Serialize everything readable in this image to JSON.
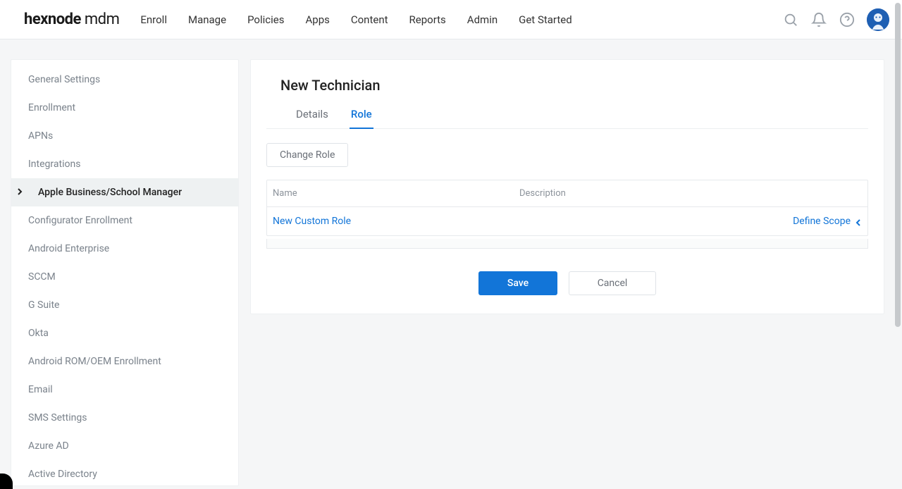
{
  "brand": {
    "bold": "hexnode",
    "light": " mdm"
  },
  "nav": {
    "items": [
      "Enroll",
      "Manage",
      "Policies",
      "Apps",
      "Content",
      "Reports",
      "Admin",
      "Get Started"
    ]
  },
  "sidebar": {
    "items": [
      {
        "label": "General Settings",
        "active": false
      },
      {
        "label": "Enrollment",
        "active": false
      },
      {
        "label": "APNs",
        "active": false
      },
      {
        "label": "Integrations",
        "active": false
      },
      {
        "label": "Apple Business/School Manager",
        "active": true
      },
      {
        "label": "Configurator Enrollment",
        "active": false
      },
      {
        "label": "Android Enterprise",
        "active": false
      },
      {
        "label": "SCCM",
        "active": false
      },
      {
        "label": "G Suite",
        "active": false
      },
      {
        "label": "Okta",
        "active": false
      },
      {
        "label": "Android ROM/OEM Enrollment",
        "active": false
      },
      {
        "label": "Email",
        "active": false
      },
      {
        "label": "SMS Settings",
        "active": false
      },
      {
        "label": "Azure AD",
        "active": false
      },
      {
        "label": "Active Directory",
        "active": false
      }
    ]
  },
  "page": {
    "title": "New Technician",
    "tabs": [
      {
        "label": "Details",
        "active": false
      },
      {
        "label": "Role",
        "active": true
      }
    ],
    "change_role": "Change Role",
    "table": {
      "headers": {
        "name": "Name",
        "description": "Description"
      },
      "row": {
        "name": "New Custom Role",
        "description": "",
        "action": "Define Scope"
      }
    },
    "actions": {
      "save": "Save",
      "cancel": "Cancel"
    }
  }
}
